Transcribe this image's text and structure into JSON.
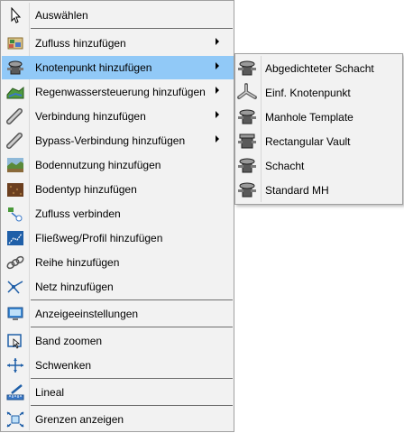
{
  "context_menu": {
    "items": [
      {
        "label": "Auswählen",
        "icon": "pointer-arrow-icon",
        "submenu": false
      },
      {
        "label": "Zufluss hinzufügen",
        "icon": "inflow-icon",
        "submenu": true
      },
      {
        "label": "Knotenpunkt hinzufügen",
        "icon": "manhole-node-icon",
        "submenu": true,
        "highlighted": true
      },
      {
        "label": "Regenwassersteuerung hinzufügen",
        "icon": "stormwater-control-icon",
        "submenu": true
      },
      {
        "label": "Verbindung hinzufügen",
        "icon": "pipe-link-icon",
        "submenu": true
      },
      {
        "label": "Bypass-Verbindung hinzufügen",
        "icon": "bypass-pipe-icon",
        "submenu": true
      },
      {
        "label": "Bodennutzung hinzufügen",
        "icon": "land-use-icon",
        "submenu": false
      },
      {
        "label": "Bodentyp hinzufügen",
        "icon": "soil-type-icon",
        "submenu": false
      },
      {
        "label": "Zufluss verbinden",
        "icon": "connect-inflow-icon",
        "submenu": false
      },
      {
        "label": "Fließweg/Profil hinzufügen",
        "icon": "flow-path-icon",
        "submenu": false
      },
      {
        "label": "Reihe hinzufügen",
        "icon": "chain-row-icon",
        "submenu": false
      },
      {
        "label": "Netz hinzufügen",
        "icon": "network-icon",
        "submenu": false
      },
      {
        "label": "Anzeigeeinstellungen",
        "icon": "display-settings-icon",
        "submenu": false
      },
      {
        "label": "Band zoomen",
        "icon": "zoom-window-icon",
        "submenu": false
      },
      {
        "label": "Schwenken",
        "icon": "pan-icon",
        "submenu": false
      },
      {
        "label": "Lineal",
        "icon": "ruler-icon",
        "submenu": false
      },
      {
        "label": "Grenzen anzeigen",
        "icon": "zoom-extents-icon",
        "submenu": false
      }
    ]
  },
  "submenu": {
    "items": [
      {
        "label": "Abgedichteter Schacht",
        "icon": "sealed-manhole-icon"
      },
      {
        "label": "Einf. Knotenpunkt",
        "icon": "simple-junction-icon"
      },
      {
        "label": "Manhole Template",
        "icon": "manhole-template-icon"
      },
      {
        "label": "Rectangular Vault",
        "icon": "rectangular-vault-icon"
      },
      {
        "label": "Schacht",
        "icon": "manhole-icon"
      },
      {
        "label": "Standard MH",
        "icon": "standard-mh-icon"
      }
    ]
  },
  "colors": {
    "menu_background": "#f2f2f2",
    "highlight": "#91c9f7",
    "border": "#a0a0a0"
  }
}
